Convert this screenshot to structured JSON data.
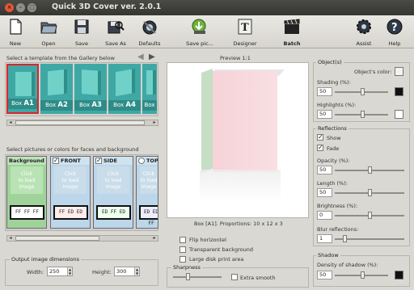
{
  "app": {
    "title": "Quick 3D Cover ver. 2.0.1"
  },
  "toolbar": {
    "new": "New",
    "open": "Open",
    "save": "Save",
    "save_as": "Save As",
    "defaults": "Defaults",
    "save_pic": "Save pic...",
    "designer": "Designer",
    "batch": "Batch",
    "assist": "Assist",
    "help": "Help"
  },
  "gallery": {
    "label": "Select a template from the Gallery below",
    "templates": [
      {
        "prefix": "Box",
        "code": "A1"
      },
      {
        "prefix": "Box",
        "code": "A2"
      },
      {
        "prefix": "Box",
        "code": "A3"
      },
      {
        "prefix": "Box",
        "code": "A4"
      },
      {
        "prefix": "Box",
        "code": ""
      }
    ]
  },
  "faces": {
    "label": "Select pictures or colors for faces and background",
    "items": [
      {
        "title": "Background",
        "click": "Click\nto load\nimage",
        "swatch": "FF FF FF",
        "checked": false
      },
      {
        "title": "FRONT",
        "click": "Click\nto load\nimage",
        "swatch": "FF ED ED",
        "checked": true
      },
      {
        "title": "SIDE",
        "click": "Click\nto load\nimage",
        "swatch": "ED FF ED",
        "checked": true
      },
      {
        "title": "TOP",
        "click": "Click\nto load\nimage",
        "swatch": "ED ED FF",
        "checked": false
      }
    ]
  },
  "output": {
    "group_title": "Output image dimensions",
    "width_label": "Width:",
    "width_value": "250",
    "height_label": "Height:",
    "height_value": "300"
  },
  "preview": {
    "title": "Preview 1:1",
    "caption": "Box [A1]. Proportions: 10 x 12 x 3",
    "flip_horizontal": "Flip horizontel",
    "transparent_background": "Transparent background",
    "large_disk_print": "Large disk print area",
    "sharpness_title": "Sharpness",
    "extra_smooth": "Extra smooth"
  },
  "objects": {
    "group_title": "Object(s)",
    "color_label": "Object's color:",
    "shading_label": "Shading (%):",
    "shading_value": "50",
    "highlights_label": "Highlights (%):",
    "highlights_value": "50"
  },
  "reflections": {
    "group_title": "Reflections",
    "show": "Show",
    "fade": "Fade",
    "opacity_label": "Opacity (%):",
    "opacity_value": "50",
    "length_label": "Length (%):",
    "length_value": "50",
    "brightness_label": "Brightness (%):",
    "brightness_value": "0",
    "blur_label": "Blur reflections:",
    "blur_value": "1"
  },
  "shadow": {
    "group_title": "Shadow",
    "density_label": "Density of shadow (%):",
    "density_value": "50"
  },
  "colors": {
    "accent_teal": "#3fa8a5",
    "front": "#ffeded",
    "side": "#edffed",
    "top": "#ededff"
  }
}
